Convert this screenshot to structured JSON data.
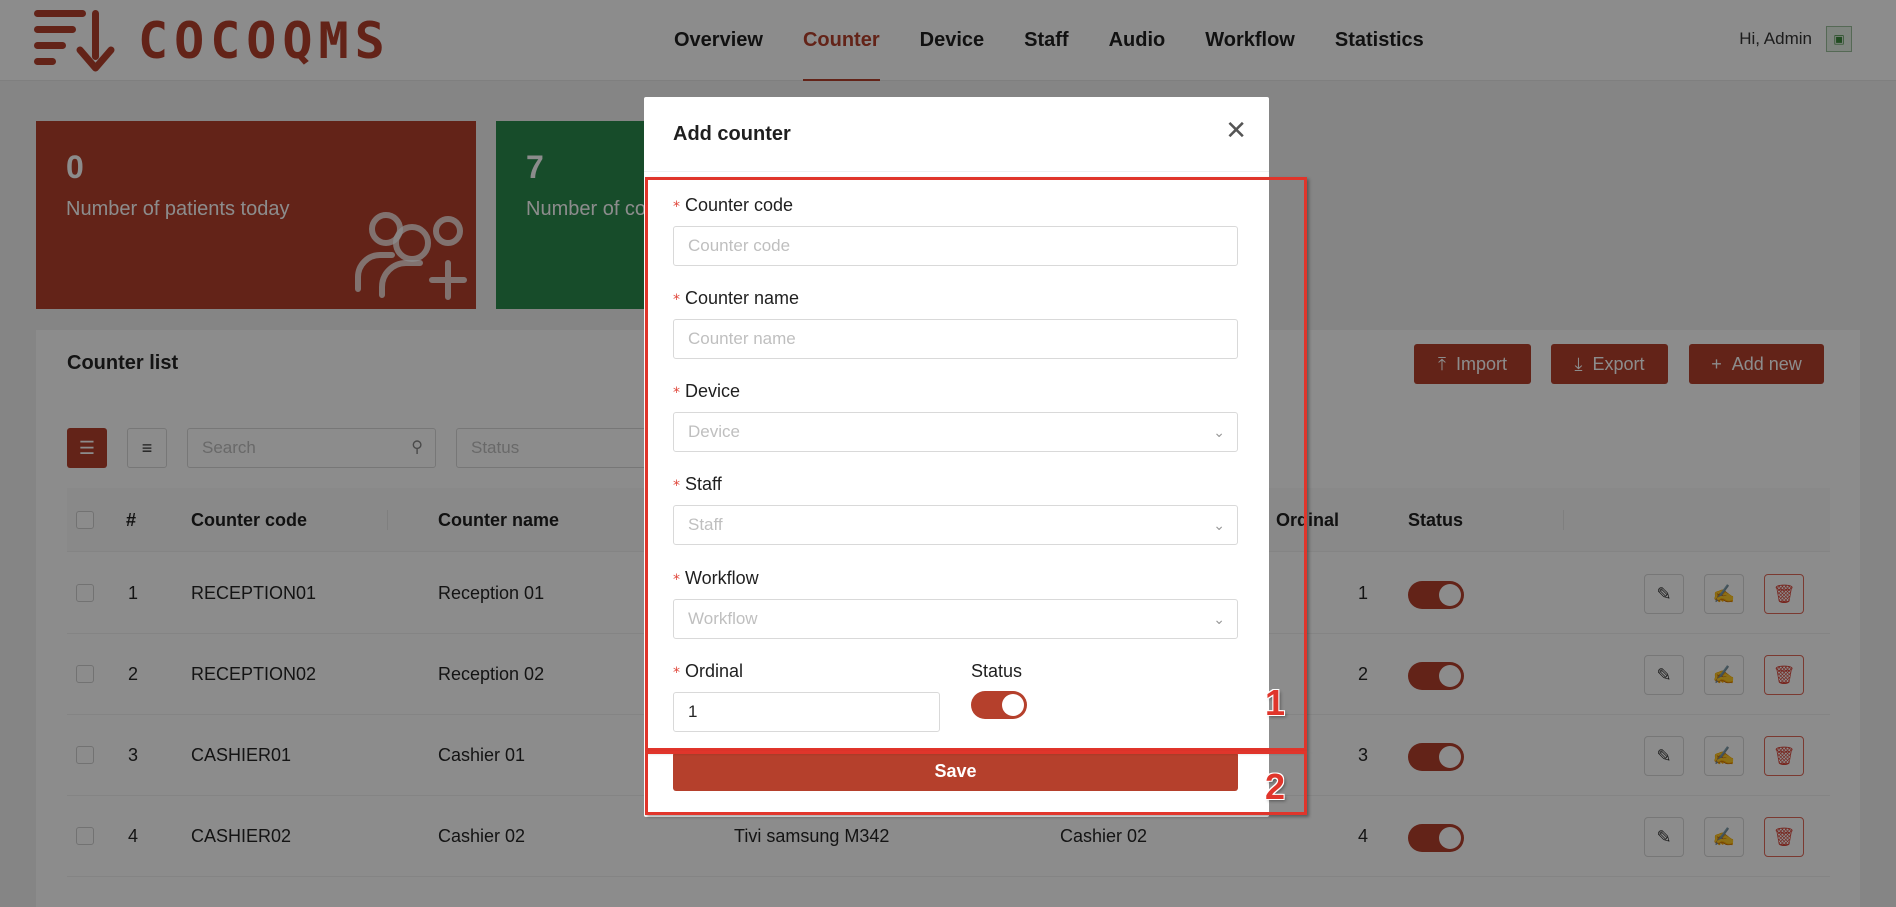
{
  "brand": {
    "name": "COCOQMS",
    "color": "#b5402c"
  },
  "nav": {
    "items": [
      "Overview",
      "Counter",
      "Device",
      "Staff",
      "Audio",
      "Workflow",
      "Statistics"
    ],
    "active": "Counter"
  },
  "user": {
    "greeting": "Hi, Admin"
  },
  "stats": [
    {
      "value": "0",
      "label": "Number of patients today",
      "icon": "users-add-icon",
      "color": "#b5402c"
    },
    {
      "value": "7",
      "label": "Number of co",
      "color": "#2a8a4e"
    }
  ],
  "list": {
    "title": "Counter list",
    "buttons": {
      "import": "Import",
      "export": "Export",
      "add_new": "Add new"
    },
    "search_placeholder": "Search",
    "status_placeholder": "Status",
    "columns": {
      "index": "#",
      "code": "Counter code",
      "name": "Counter name",
      "ordinal": "Ordinal",
      "status": "Status"
    },
    "rows": [
      {
        "index": "1",
        "code": "RECEPTION01",
        "name": "Reception 01",
        "device": "",
        "staff": "",
        "ordinal": "1",
        "status": true
      },
      {
        "index": "2",
        "code": "RECEPTION02",
        "name": "Reception 02",
        "device": "",
        "staff": "",
        "ordinal": "2",
        "status": true
      },
      {
        "index": "3",
        "code": "CASHIER01",
        "name": "Cashier 01",
        "device": "",
        "staff": "",
        "ordinal": "3",
        "status": true
      },
      {
        "index": "4",
        "code": "CASHIER02",
        "name": "Cashier 02",
        "device": "Tivi samsung M342",
        "staff": "Cashier 02",
        "ordinal": "4",
        "status": true
      }
    ]
  },
  "modal": {
    "title": "Add counter",
    "required_mark": "*",
    "fields": {
      "code": {
        "label": "Counter code",
        "placeholder": "Counter code"
      },
      "name": {
        "label": "Counter name",
        "placeholder": "Counter name"
      },
      "device": {
        "label": "Device",
        "placeholder": "Device"
      },
      "staff": {
        "label": "Staff",
        "placeholder": "Staff"
      },
      "workflow": {
        "label": "Workflow",
        "placeholder": "Workflow"
      },
      "ordinal": {
        "label": "Ordinal",
        "value": "1"
      },
      "status": {
        "label": "Status",
        "value": true
      }
    },
    "save_label": "Save"
  },
  "annotations": {
    "box1": "1",
    "box2": "2",
    "color": "#e0352b"
  }
}
